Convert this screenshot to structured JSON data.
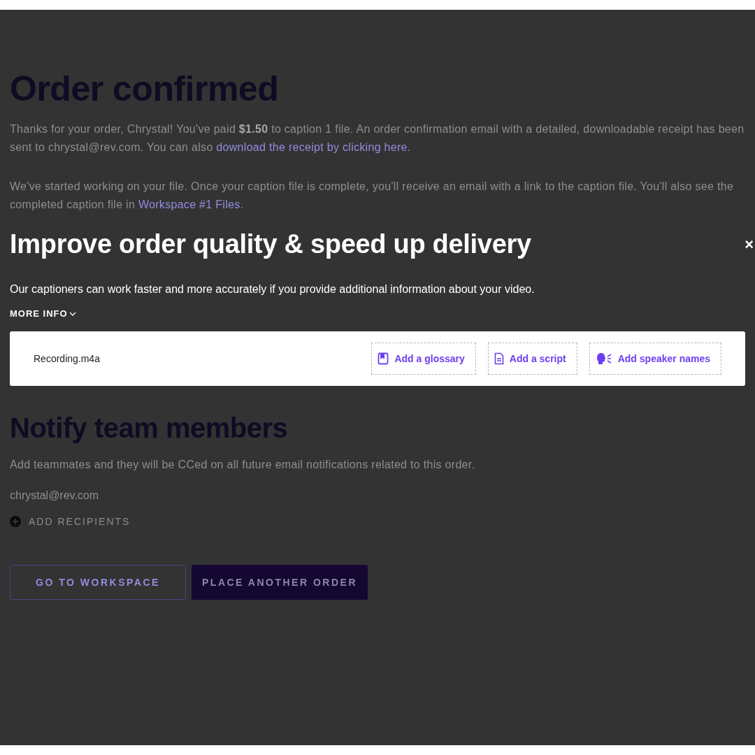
{
  "order": {
    "title": "Order confirmed",
    "paragraphs": [
      [
        {
          "kind": "text",
          "text": "Thanks for your order, Chrystal!  You've paid **$1.50** to caption 1 file. An order confirmation email with a detailed, downloadable receipt has been sent to chrystal@rev.com. You can also "
        },
        {
          "kind": "link",
          "text": "download the receipt by clicking here"
        },
        {
          "kind": "text",
          "text": "."
        }
      ],
      [
        {
          "kind": "text",
          "text": "We've started working on your file. Once your caption file is complete, you'll receive an email with a link to the caption file. You'll also see the completed caption file in "
        },
        {
          "kind": "link",
          "text": "Workspace #1 Files"
        },
        {
          "kind": "text",
          "text": "."
        }
      ]
    ]
  },
  "modal": {
    "title": "Improve order quality & speed up delivery",
    "close": "×",
    "description": "Our captioners can work faster and more accurately if you provide additional information about your video.",
    "more_info": "MORE INFO",
    "expanded": false,
    "file": {
      "name": "Recording.m4a",
      "actions": [
        {
          "kind": "glossary",
          "label": "Add a glossary"
        },
        {
          "kind": "script",
          "label": "Add a script"
        },
        {
          "kind": "speakers",
          "label": "Add speaker names"
        }
      ]
    }
  },
  "notify": {
    "title": "Notify team members",
    "description": "Add teammates and they will be CCed on all future email notifications related to this order.",
    "email": "chrystal@rev.com",
    "add_label": "ADD RECIPIENTS",
    "buttons": [
      {
        "kind": "secondary",
        "label": "GO TO WORKSPACE"
      },
      {
        "kind": "primary",
        "label": "PLACE ANOTHER ORDER"
      }
    ]
  }
}
